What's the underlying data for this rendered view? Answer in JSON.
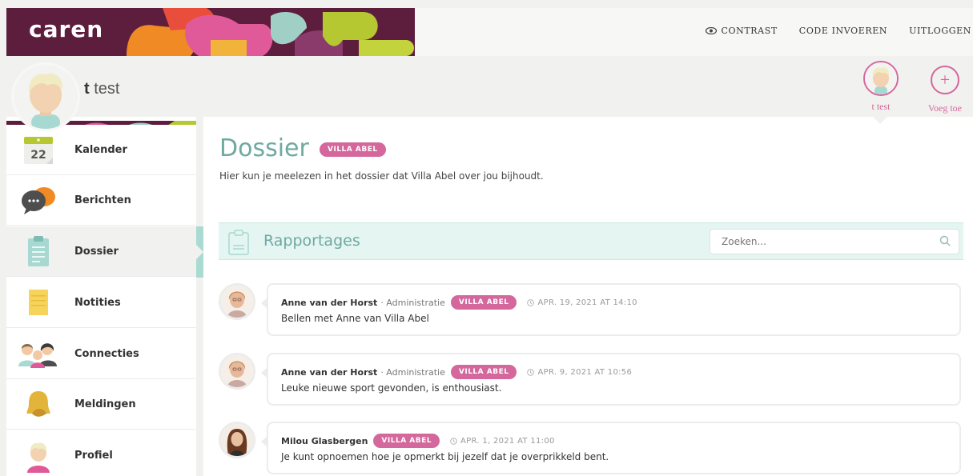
{
  "app": {
    "logo": "caren"
  },
  "topnav": {
    "contrast": "CONTRAST",
    "code": "CODE INVOEREN",
    "logout": "UITLOGGEN"
  },
  "profile": {
    "initial": "t",
    "name": "test",
    "switch_label": "t test",
    "add_label": "Voeg toe"
  },
  "sidebar": {
    "items": [
      {
        "label": "Kalender",
        "icon": "calendar-icon",
        "day": "22"
      },
      {
        "label": "Berichten",
        "icon": "chat-bubbles-icon"
      },
      {
        "label": "Dossier",
        "icon": "clipboard-icon",
        "active": true
      },
      {
        "label": "Notities",
        "icon": "notepad-icon"
      },
      {
        "label": "Connecties",
        "icon": "people-icon"
      },
      {
        "label": "Meldingen",
        "icon": "bell-icon"
      },
      {
        "label": "Profiel",
        "icon": "profile-icon"
      }
    ]
  },
  "main": {
    "title": "Dossier",
    "badge": "VILLA ABEL",
    "intro": "Hier kun je meelezen in het dossier dat Villa Abel over jou bijhoudt.",
    "section_title": "Rapportages",
    "search_placeholder": "Zoeken..."
  },
  "entries": [
    {
      "author": "Anne van der Horst",
      "role": "· Administratie",
      "badge": "VILLA ABEL",
      "date": "APR. 19, 2021 AT 14:10",
      "text": "Bellen met Anne van Villa Abel"
    },
    {
      "author": "Anne van der Horst",
      "role": "· Administratie",
      "badge": "VILLA ABEL",
      "date": "APR. 9, 2021 AT 10:56",
      "text": "Leuke nieuwe sport gevonden, is enthousiast."
    },
    {
      "author": "Milou Glasbergen",
      "role": "",
      "badge": "VILLA ABEL",
      "date": "APR. 1, 2021 AT 11:00",
      "text": "Je kunt opnoemen hoe je opmerkt bij jezelf dat je overprikkeld bent."
    }
  ],
  "colors": {
    "accent": "#d4679c",
    "teal": "#6fa9a2",
    "plum": "#6b2546",
    "orange": "#f08a24",
    "lime": "#b5c832"
  }
}
